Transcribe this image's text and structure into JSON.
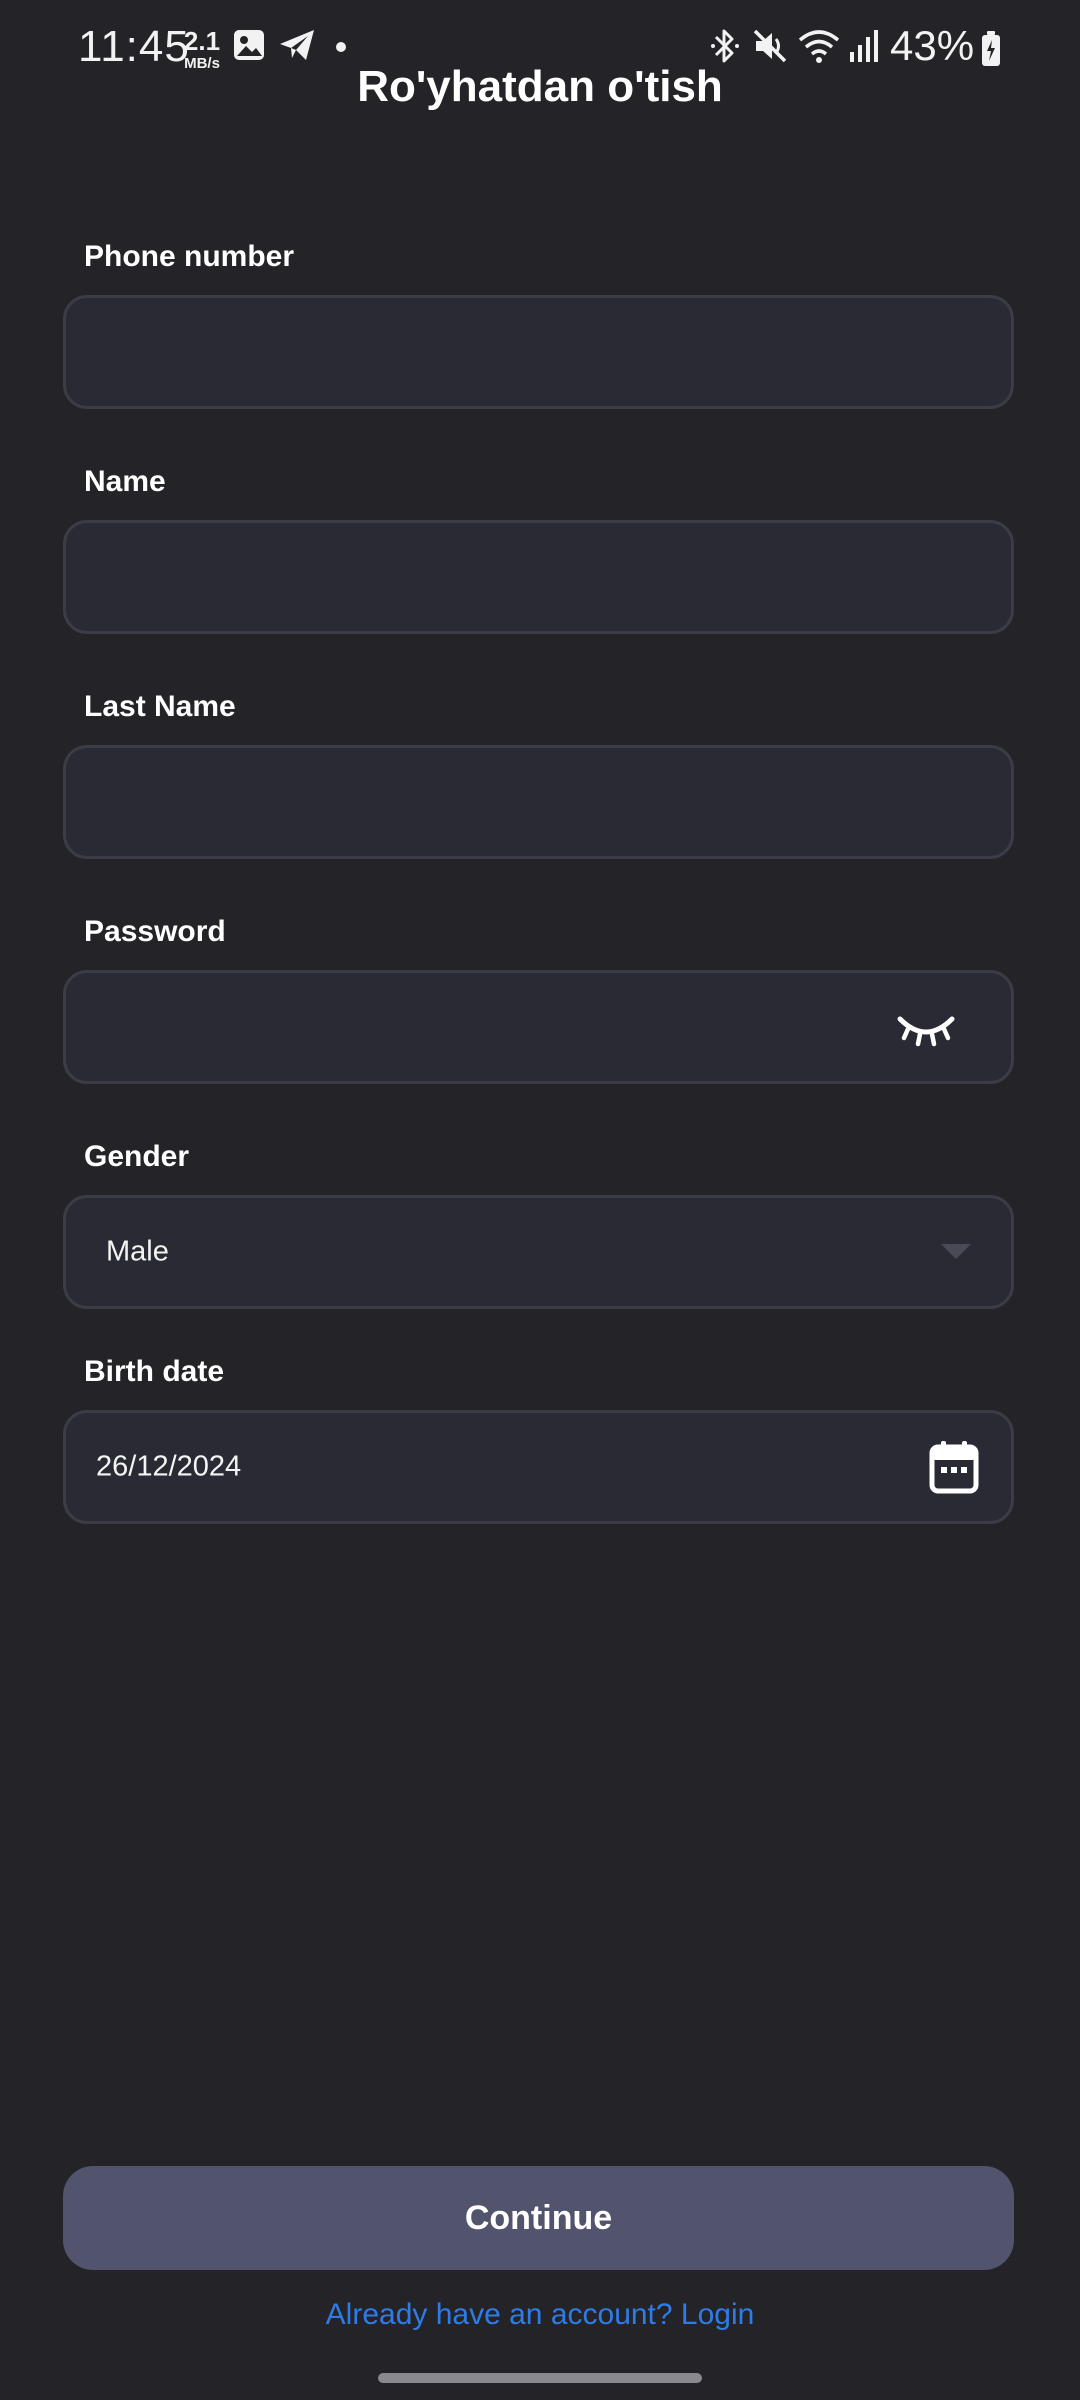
{
  "status_bar": {
    "time": "11:45",
    "net_speed_value": "2.1",
    "net_speed_unit": "MB/s",
    "battery": "43%",
    "icons": [
      "gallery-icon",
      "telegram-icon",
      "dot-icon",
      "bluetooth-icon",
      "mute-icon",
      "wifi-icon",
      "signal-icon",
      "battery-icon"
    ]
  },
  "title": "Ro'yhatdan o'tish",
  "form": {
    "phone": {
      "label": "Phone number",
      "value": ""
    },
    "name": {
      "label": "Name",
      "value": ""
    },
    "last_name": {
      "label": "Last Name",
      "value": ""
    },
    "password": {
      "label": "Password",
      "value": "",
      "icon": "eye-closed-icon"
    },
    "gender": {
      "label": "Gender",
      "value": "Male",
      "icon": "dropdown-arrow-icon"
    },
    "birth_date": {
      "label": "Birth date",
      "value": "26/12/2024",
      "icon": "calendar-icon"
    }
  },
  "continue_label": "Continue",
  "login_link": "Already have an account? Login",
  "colors": {
    "background": "#232328",
    "field_background": "#2a2a34",
    "field_border": "#3c3c46",
    "button": "#52546d",
    "link": "#2f7ce6"
  }
}
